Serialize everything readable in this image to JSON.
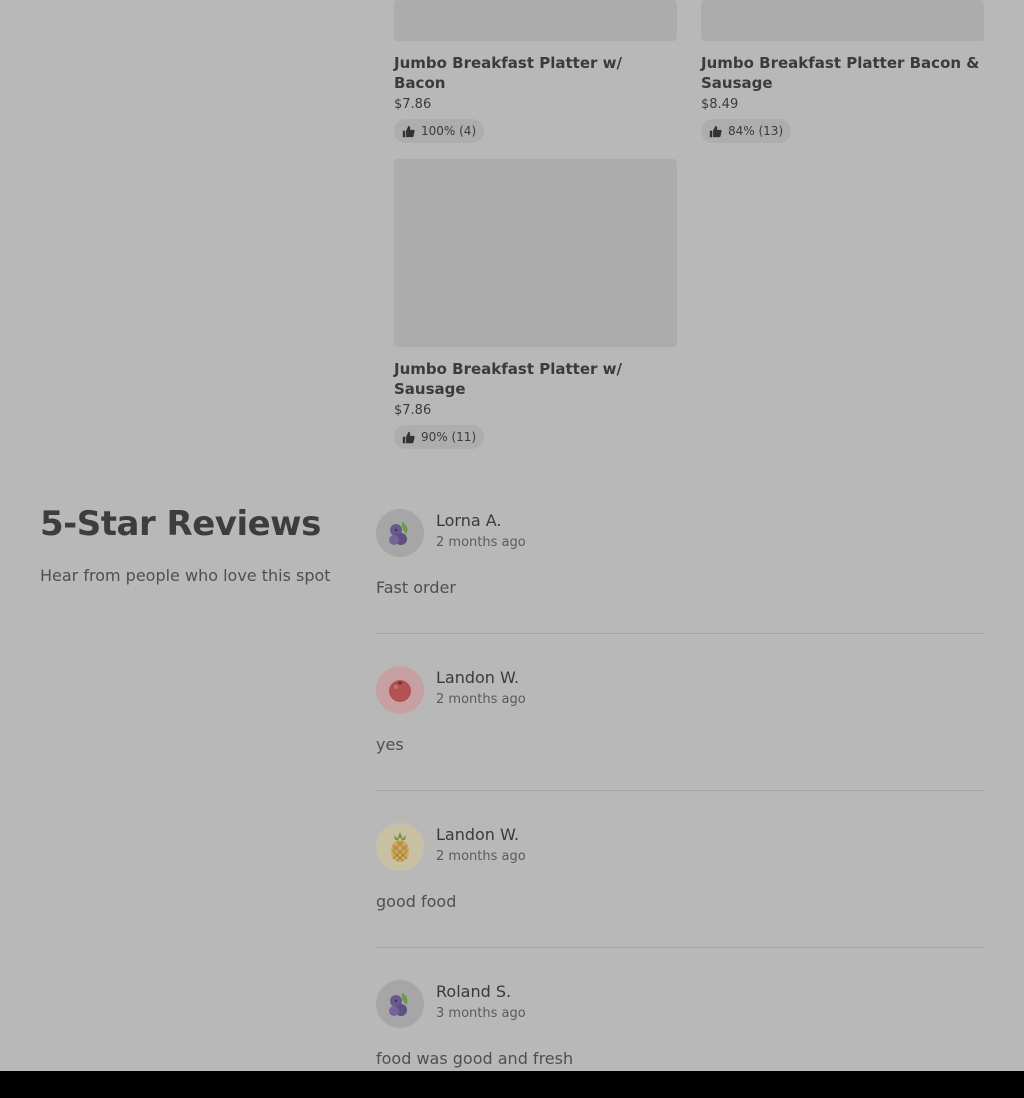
{
  "products": [
    {
      "name": "Jumbo Breakfast Platter w/ Bacon",
      "price": "$7.86",
      "rating": "100% (4)"
    },
    {
      "name": "Jumbo Breakfast Platter Bacon & Sausage",
      "price": "$8.49",
      "rating": "84% (13)"
    },
    {
      "name": "Jumbo Breakfast Platter w/ Sausage",
      "price": "$7.86",
      "rating": "90% (11)"
    }
  ],
  "reviews_section": {
    "title": "5-Star Reviews",
    "subtitle": "Hear from people who love this spot"
  },
  "reviews": [
    {
      "name": "Lorna A.",
      "date": "2 months ago",
      "text": "Fast order",
      "avatar": "blueberry-icon"
    },
    {
      "name": "Landon W.",
      "date": "2 months ago",
      "text": "yes",
      "avatar": "cherry-icon"
    },
    {
      "name": "Landon W.",
      "date": "2 months ago",
      "text": "good food",
      "avatar": "pineapple-icon"
    },
    {
      "name": "Roland S.",
      "date": "3 months ago",
      "text": "food was good and fresh",
      "avatar": "blueberry-icon"
    }
  ]
}
